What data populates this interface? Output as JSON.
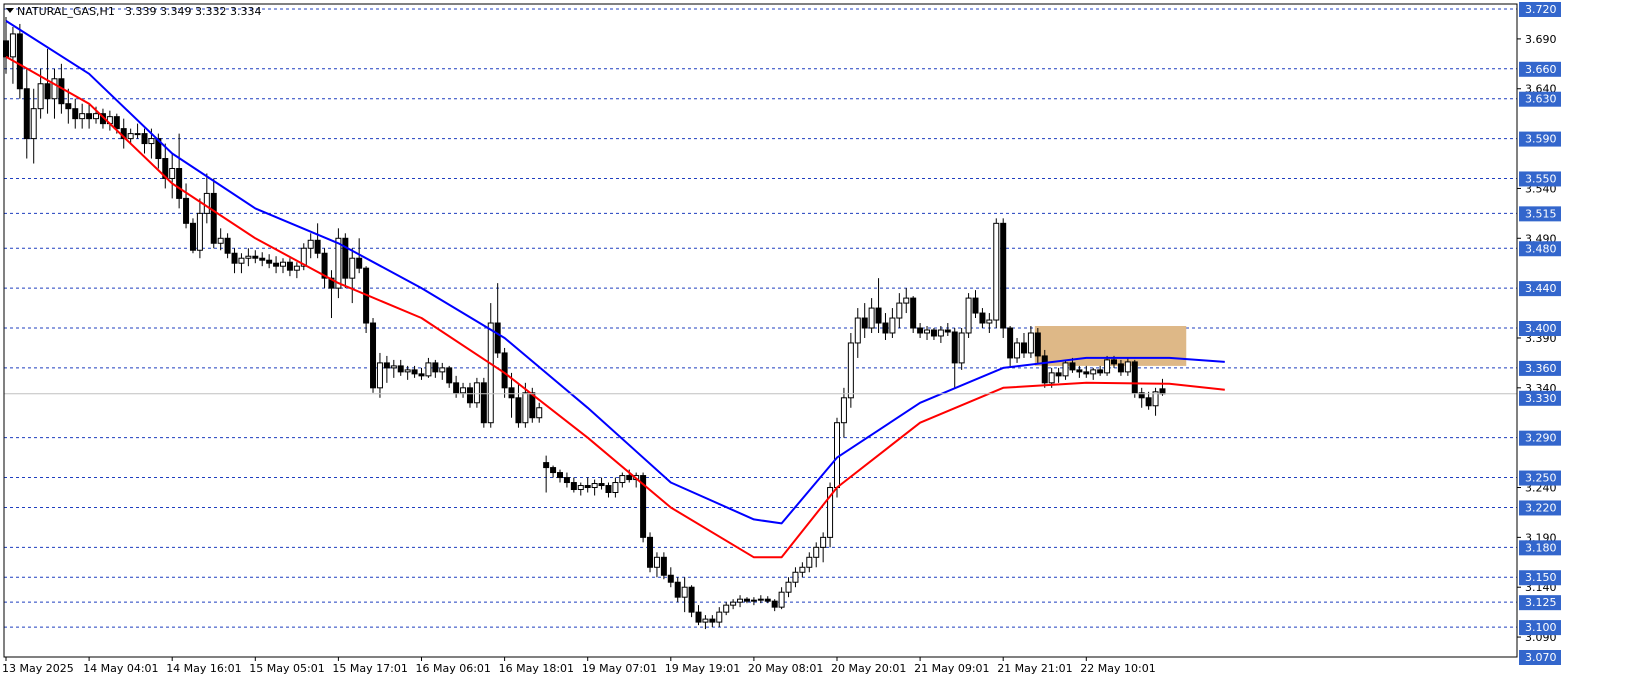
{
  "header": {
    "symbol": "NATURAL_GAS,H1",
    "ohlc": "3.339 3.349 3.332 3.334"
  },
  "colors": {
    "background": "#ffffff",
    "grid_dashed": "#1f3fbf",
    "ema_fast": "#0000ff",
    "ema_slow": "#ff0000",
    "zone": "#deb887",
    "price_label_bg": "#3366cc",
    "current_price_line": "#c0c0c0",
    "candle": "#000000"
  },
  "chart_data": {
    "type": "candlestick",
    "symbol": "NATURAL_GAS",
    "timeframe": "H1",
    "ylim": [
      3.07,
      3.725
    ],
    "y_axis_side": "right",
    "grid": "horizontal dashed at labeled levels",
    "y_labels_plain": [
      "3.690",
      "3.640",
      "3.540",
      "3.490",
      "3.390",
      "3.340",
      "3.240",
      "3.190",
      "3.140",
      "3.090"
    ],
    "y_labels_highlighted": [
      "3.720",
      "3.660",
      "3.630",
      "3.590",
      "3.550",
      "3.515",
      "3.480",
      "3.440",
      "3.400",
      "3.360",
      "3.330",
      "3.290",
      "3.250",
      "3.220",
      "3.180",
      "3.150",
      "3.125",
      "3.100",
      "3.070"
    ],
    "horizontal_levels": [
      3.72,
      3.66,
      3.63,
      3.59,
      3.55,
      3.515,
      3.48,
      3.44,
      3.4,
      3.36,
      3.29,
      3.25,
      3.22,
      3.18,
      3.15,
      3.125,
      3.1
    ],
    "current_price": 3.334,
    "x_labels": [
      "13 May 2025",
      "14 May 04:01",
      "14 May 16:01",
      "15 May 05:01",
      "15 May 17:01",
      "16 May 06:01",
      "16 May 18:01",
      "19 May 07:01",
      "19 May 19:01",
      "20 May 08:01",
      "20 May 20:01",
      "21 May 09:01",
      "21 May 21:01",
      "22 May 10:01"
    ],
    "bars_per_label": 12,
    "zone": {
      "from_bar": 149,
      "to_bar": 170,
      "low": 3.362,
      "high": 3.402
    },
    "gaps_after_bars": [
      80
    ],
    "ohlc": [
      [
        3.688,
        3.712,
        3.655,
        3.672
      ],
      [
        3.672,
        3.702,
        3.645,
        3.695
      ],
      [
        3.695,
        3.705,
        3.63,
        3.64
      ],
      [
        3.64,
        3.66,
        3.57,
        3.59
      ],
      [
        3.59,
        3.64,
        3.565,
        3.62
      ],
      [
        3.62,
        3.66,
        3.61,
        3.645
      ],
      [
        3.645,
        3.68,
        3.615,
        3.63
      ],
      [
        3.63,
        3.66,
        3.61,
        3.65
      ],
      [
        3.65,
        3.665,
        3.615,
        3.625
      ],
      [
        3.625,
        3.64,
        3.605,
        3.62
      ],
      [
        3.62,
        3.63,
        3.6,
        3.61
      ],
      [
        3.61,
        3.625,
        3.6,
        3.615
      ],
      [
        3.615,
        3.625,
        3.6,
        3.61
      ],
      [
        3.61,
        3.622,
        3.605,
        3.615
      ],
      [
        3.615,
        3.62,
        3.6,
        3.605
      ],
      [
        3.605,
        3.618,
        3.598,
        3.612
      ],
      [
        3.612,
        3.615,
        3.595,
        3.6
      ],
      [
        3.6,
        3.61,
        3.58,
        3.59
      ],
      [
        3.59,
        3.6,
        3.585,
        3.595
      ],
      [
        3.595,
        3.605,
        3.59,
        3.595
      ],
      [
        3.595,
        3.6,
        3.575,
        3.585
      ],
      [
        3.585,
        3.6,
        3.57,
        3.59
      ],
      [
        3.59,
        3.595,
        3.56,
        3.57
      ],
      [
        3.57,
        3.585,
        3.54,
        3.55
      ],
      [
        3.55,
        3.575,
        3.53,
        3.56
      ],
      [
        3.56,
        3.595,
        3.52,
        3.53
      ],
      [
        3.53,
        3.545,
        3.5,
        3.505
      ],
      [
        3.505,
        3.51,
        3.475,
        3.478
      ],
      [
        3.478,
        3.53,
        3.47,
        3.515
      ],
      [
        3.515,
        3.555,
        3.505,
        3.535
      ],
      [
        3.535,
        3.55,
        3.48,
        3.485
      ],
      [
        3.485,
        3.5,
        3.478,
        3.49
      ],
      [
        3.49,
        3.495,
        3.47,
        3.475
      ],
      [
        3.475,
        3.48,
        3.455,
        3.465
      ],
      [
        3.465,
        3.475,
        3.455,
        3.47
      ],
      [
        3.47,
        3.48,
        3.462,
        3.472
      ],
      [
        3.472,
        3.478,
        3.465,
        3.47
      ],
      [
        3.47,
        3.476,
        3.462,
        3.468
      ],
      [
        3.468,
        3.474,
        3.46,
        3.465
      ],
      [
        3.465,
        3.472,
        3.455,
        3.462
      ],
      [
        3.462,
        3.47,
        3.455,
        3.466
      ],
      [
        3.466,
        3.47,
        3.452,
        3.458
      ],
      [
        3.458,
        3.466,
        3.45,
        3.462
      ],
      [
        3.462,
        3.485,
        3.458,
        3.48
      ],
      [
        3.48,
        3.495,
        3.47,
        3.488
      ],
      [
        3.488,
        3.505,
        3.47,
        3.475
      ],
      [
        3.475,
        3.48,
        3.44,
        3.45
      ],
      [
        3.45,
        3.458,
        3.41,
        3.44
      ],
      [
        3.44,
        3.5,
        3.43,
        3.49
      ],
      [
        3.49,
        3.495,
        3.44,
        3.45
      ],
      [
        3.45,
        3.48,
        3.425,
        3.47
      ],
      [
        3.47,
        3.49,
        3.455,
        3.46
      ],
      [
        3.46,
        3.462,
        3.395,
        3.405
      ],
      [
        3.405,
        3.41,
        3.335,
        3.34
      ],
      [
        3.34,
        3.375,
        3.33,
        3.365
      ],
      [
        3.365,
        3.372,
        3.345,
        3.36
      ],
      [
        3.36,
        3.368,
        3.35,
        3.362
      ],
      [
        3.362,
        3.368,
        3.352,
        3.356
      ],
      [
        3.356,
        3.362,
        3.348,
        3.358
      ],
      [
        3.358,
        3.362,
        3.35,
        3.354
      ],
      [
        3.354,
        3.36,
        3.348,
        3.352
      ],
      [
        3.352,
        3.37,
        3.35,
        3.365
      ],
      [
        3.365,
        3.368,
        3.35,
        3.356
      ],
      [
        3.356,
        3.365,
        3.348,
        3.36
      ],
      [
        3.36,
        3.362,
        3.34,
        3.345
      ],
      [
        3.345,
        3.352,
        3.33,
        3.335
      ],
      [
        3.335,
        3.345,
        3.33,
        3.34
      ],
      [
        3.34,
        3.345,
        3.32,
        3.325
      ],
      [
        3.325,
        3.35,
        3.32,
        3.345
      ],
      [
        3.345,
        3.35,
        3.3,
        3.305
      ],
      [
        3.305,
        3.425,
        3.3,
        3.405
      ],
      [
        3.405,
        3.445,
        3.37,
        3.375
      ],
      [
        3.375,
        3.38,
        3.33,
        3.34
      ],
      [
        3.34,
        3.355,
        3.31,
        3.33
      ],
      [
        3.33,
        3.345,
        3.3,
        3.305
      ],
      [
        3.305,
        3.345,
        3.3,
        3.335
      ],
      [
        3.335,
        3.34,
        3.305,
        3.31
      ],
      [
        3.31,
        3.325,
        3.305,
        3.32
      ],
      [
        3.265,
        3.272,
        3.235,
        3.26
      ],
      [
        3.26,
        3.262,
        3.25,
        3.255
      ],
      [
        3.255,
        3.258,
        3.245,
        3.25
      ],
      [
        3.25,
        3.255,
        3.24,
        3.245
      ],
      [
        3.245,
        3.25,
        3.235,
        3.238
      ],
      [
        3.238,
        3.245,
        3.232,
        3.242
      ],
      [
        3.242,
        3.25,
        3.235,
        3.24
      ],
      [
        3.24,
        3.248,
        3.232,
        3.244
      ],
      [
        3.244,
        3.25,
        3.238,
        3.242
      ],
      [
        3.242,
        3.245,
        3.23,
        3.235
      ],
      [
        3.235,
        3.25,
        3.23,
        3.245
      ],
      [
        3.245,
        3.255,
        3.24,
        3.252
      ],
      [
        3.252,
        3.258,
        3.245,
        3.248
      ],
      [
        3.248,
        3.255,
        3.24,
        3.252
      ],
      [
        3.252,
        3.255,
        3.185,
        3.19
      ],
      [
        3.19,
        3.195,
        3.155,
        3.16
      ],
      [
        3.16,
        3.175,
        3.15,
        3.17
      ],
      [
        3.17,
        3.175,
        3.148,
        3.152
      ],
      [
        3.152,
        3.16,
        3.14,
        3.145
      ],
      [
        3.145,
        3.15,
        3.125,
        3.13
      ],
      [
        3.13,
        3.15,
        3.115,
        3.14
      ],
      [
        3.14,
        3.142,
        3.11,
        3.115
      ],
      [
        3.115,
        3.122,
        3.102,
        3.105
      ],
      [
        3.105,
        3.112,
        3.098,
        3.108
      ],
      [
        3.108,
        3.112,
        3.1,
        3.105
      ],
      [
        3.105,
        3.12,
        3.1,
        3.115
      ],
      [
        3.115,
        3.125,
        3.112,
        3.122
      ],
      [
        3.122,
        3.128,
        3.118,
        3.125
      ],
      [
        3.125,
        3.132,
        3.12,
        3.128
      ],
      [
        3.128,
        3.13,
        3.124,
        3.126
      ],
      [
        3.126,
        3.13,
        3.122,
        3.127
      ],
      [
        3.127,
        3.132,
        3.124,
        3.128
      ],
      [
        3.128,
        3.131,
        3.124,
        3.126
      ],
      [
        3.126,
        3.128,
        3.116,
        3.12
      ],
      [
        3.12,
        3.14,
        3.118,
        3.135
      ],
      [
        3.135,
        3.15,
        3.13,
        3.145
      ],
      [
        3.145,
        3.16,
        3.14,
        3.155
      ],
      [
        3.155,
        3.165,
        3.15,
        3.16
      ],
      [
        3.16,
        3.175,
        3.155,
        3.17
      ],
      [
        3.17,
        3.185,
        3.16,
        3.18
      ],
      [
        3.18,
        3.195,
        3.165,
        3.19
      ],
      [
        3.19,
        3.245,
        3.18,
        3.24
      ],
      [
        3.24,
        3.31,
        3.23,
        3.305
      ],
      [
        3.305,
        3.34,
        3.29,
        3.33
      ],
      [
        3.33,
        3.395,
        3.32,
        3.385
      ],
      [
        3.385,
        3.42,
        3.37,
        3.41
      ],
      [
        3.41,
        3.425,
        3.39,
        3.4
      ],
      [
        3.4,
        3.43,
        3.395,
        3.42
      ],
      [
        3.42,
        3.45,
        3.395,
        3.405
      ],
      [
        3.405,
        3.415,
        3.388,
        3.395
      ],
      [
        3.395,
        3.42,
        3.39,
        3.41
      ],
      [
        3.41,
        3.435,
        3.4,
        3.425
      ],
      [
        3.425,
        3.44,
        3.415,
        3.43
      ],
      [
        3.43,
        3.432,
        3.395,
        3.4
      ],
      [
        3.4,
        3.405,
        3.39,
        3.395
      ],
      [
        3.395,
        3.402,
        3.388,
        3.398
      ],
      [
        3.398,
        3.4,
        3.388,
        3.392
      ],
      [
        3.392,
        3.402,
        3.385,
        3.398
      ],
      [
        3.398,
        3.405,
        3.392,
        3.396
      ],
      [
        3.396,
        3.4,
        3.34,
        3.365
      ],
      [
        3.365,
        3.4,
        3.358,
        3.395
      ],
      [
        3.395,
        3.435,
        3.39,
        3.43
      ],
      [
        3.43,
        3.438,
        3.41,
        3.415
      ],
      [
        3.415,
        3.42,
        3.4,
        3.405
      ],
      [
        3.405,
        3.415,
        3.395,
        3.408
      ],
      [
        3.408,
        3.51,
        3.4,
        3.505
      ],
      [
        3.505,
        3.51,
        3.39,
        3.4
      ],
      [
        3.4,
        3.402,
        3.36,
        3.37
      ],
      [
        3.37,
        3.39,
        3.365,
        3.385
      ],
      [
        3.385,
        3.395,
        3.37,
        3.375
      ],
      [
        3.375,
        3.402,
        3.37,
        3.395
      ],
      [
        3.395,
        3.4,
        3.365,
        3.372
      ],
      [
        3.372,
        3.378,
        3.34,
        3.345
      ],
      [
        3.345,
        3.36,
        3.34,
        3.355
      ],
      [
        3.355,
        3.36,
        3.345,
        3.352
      ],
      [
        3.352,
        3.368,
        3.348,
        3.365
      ],
      [
        3.365,
        3.37,
        3.355,
        3.358
      ],
      [
        3.358,
        3.362,
        3.35,
        3.356
      ],
      [
        3.356,
        3.362,
        3.35,
        3.354
      ],
      [
        3.354,
        3.36,
        3.348,
        3.358
      ],
      [
        3.358,
        3.362,
        3.352,
        3.355
      ],
      [
        3.355,
        3.372,
        3.352,
        3.368
      ],
      [
        3.368,
        3.372,
        3.36,
        3.364
      ],
      [
        3.364,
        3.368,
        3.352,
        3.356
      ],
      [
        3.356,
        3.37,
        3.352,
        3.366
      ],
      [
        3.366,
        3.368,
        3.33,
        3.335
      ],
      [
        3.335,
        3.34,
        3.32,
        3.33
      ],
      [
        3.33,
        3.336,
        3.318,
        3.322
      ],
      [
        3.322,
        3.34,
        3.312,
        3.336
      ],
      [
        3.339,
        3.349,
        3.332,
        3.334
      ]
    ],
    "series": [
      {
        "name": "",
        "type": "ma",
        "color": "#0000ff",
        "points": [
          [
            0,
            3.708
          ],
          [
            12,
            3.655
          ],
          [
            24,
            3.575
          ],
          [
            36,
            3.52
          ],
          [
            48,
            3.485
          ],
          [
            60,
            3.44
          ],
          [
            72,
            3.39
          ],
          [
            84,
            3.32
          ],
          [
            96,
            3.245
          ],
          [
            108,
            3.208
          ],
          [
            112,
            3.204
          ],
          [
            120,
            3.27
          ],
          [
            132,
            3.325
          ],
          [
            144,
            3.36
          ],
          [
            156,
            3.37
          ],
          [
            168,
            3.37
          ],
          [
            176,
            3.366
          ]
        ]
      },
      {
        "name": "",
        "type": "ma",
        "color": "#ff0000",
        "points": [
          [
            0,
            3.672
          ],
          [
            12,
            3.625
          ],
          [
            24,
            3.545
          ],
          [
            36,
            3.49
          ],
          [
            48,
            3.445
          ],
          [
            60,
            3.41
          ],
          [
            72,
            3.355
          ],
          [
            84,
            3.29
          ],
          [
            96,
            3.22
          ],
          [
            108,
            3.17
          ],
          [
            112,
            3.17
          ],
          [
            120,
            3.24
          ],
          [
            132,
            3.305
          ],
          [
            144,
            3.34
          ],
          [
            156,
            3.345
          ],
          [
            168,
            3.344
          ],
          [
            176,
            3.338
          ]
        ]
      }
    ]
  }
}
